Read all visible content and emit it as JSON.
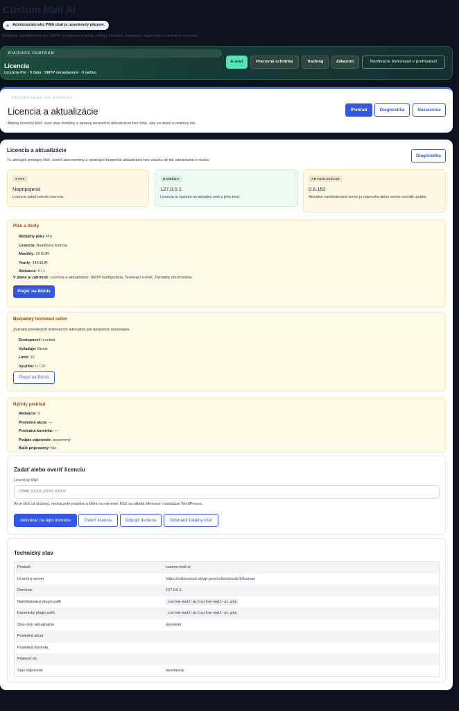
{
  "app": {
    "title": "Custom Mail AI",
    "pwa_badge": "Administrátorský PWA obal je uzamknutý plánom.",
    "subtitle": "Oddelená administrácia pre SMTP, testovacie e-maily, odbery, kontakty, kampane, diagnostiku a licenčné overenie."
  },
  "control_center": {
    "label": "RIADIACE CENTRUM",
    "title": "Licencia",
    "meta": "Licencia Pro · 0 čaká · SMTP nenastavené · 0 naživo",
    "nav": [
      {
        "label": "E-mail",
        "state": "active"
      },
      {
        "label": "Pracovná schránka",
        "state": "normal"
      },
      {
        "label": "Tracking",
        "state": "normal"
      },
      {
        "label": "Zákazníci",
        "state": "normal"
      },
      {
        "label": "Notifikácie blokované v prehliadači",
        "state": "disabled"
      }
    ]
  },
  "hero": {
    "eyebrow": "PRIPRAVENÉ NA PREDAJ",
    "title": "Licencia a aktualizácie",
    "desc": "Aktivuj licenčný kľúč, over stav domény a spravuj bezpečné aktualizácie bez toho, aby sa menil e-mailový tok.",
    "buttons": {
      "overview": "Prehľad",
      "diagnostics": "Diagnostika",
      "settings": "Nastavenia"
    }
  },
  "main": {
    "title": "Licencia a aktualizácie",
    "desc": "Tu aktivuješ predajný kľúč, overíš stav domény a spravuješ bezpečné aktualizácie bez zásahu do tok odosielania e-mailov.",
    "diagnostics_button": "Diagnostika",
    "stats": [
      {
        "label": "STAV",
        "value": "Nepripojená",
        "note": "Licencia zatiaľ nebola overená."
      },
      {
        "label": "DOMÉNA",
        "value": "127.0.0.1",
        "note": "Licencia je viazaná na aktuálny web a jeho host."
      },
      {
        "label": "AKTUALIZÁCIE",
        "value": "0.6.152",
        "note": "Aktuálne nainštalovaná verzia je najnovšia alebo server nevrátil update."
      }
    ],
    "plan": {
      "title": "Plán a limity",
      "rows": [
        {
          "k": "Aktuálny plán:",
          "v": "Pro"
        },
        {
          "k": "Licencia:",
          "v": "Neaktívna licencia"
        },
        {
          "k": "Monthly:",
          "v": "15 EUR"
        },
        {
          "k": "Yearly:",
          "v": "149 EUR"
        },
        {
          "k": "Aktivácie:",
          "v": "0 / 1"
        }
      ],
      "included_label": "V pláne je zahrnuté:",
      "included_value": "Licencia a aktualizácie, SMTP konfigurácia, Testovací e-mail, Záznamy doručovania",
      "button": "Prejsť na Biznis"
    },
    "test_mode": {
      "title": "Bezpečný testovací režim",
      "desc": "Zoznam povolených testovacích adresátov pre bezpečné overovanie.",
      "rows": [
        {
          "k": "Dostupnosť:",
          "v": "Locked"
        },
        {
          "k": "Vyžaduje:",
          "v": "Biznis"
        },
        {
          "k": "Limit:",
          "v": "10"
        },
        {
          "k": "Využitie:",
          "v": "0 / 10"
        }
      ],
      "button": "Prejsť na Biznis"
    },
    "quick": {
      "title": "Rýchly prehľad",
      "rows": [
        {
          "k": "Aktivácie:",
          "v": "0"
        },
        {
          "k": "Posledná akcia:",
          "v": "—"
        },
        {
          "k": "Posledná kontrola:",
          "v": "—"
        },
        {
          "k": "Podpis odpovede:",
          "v": "neoverený"
        },
        {
          "k": "Balík pripravený:",
          "v": "Nie"
        }
      ]
    },
    "license_form": {
      "title": "Zadať alebo overiť licenciu",
      "field_label": "Licenčný kľúč",
      "placeholder": "CMAI-XXXX-XXXX-XXXX",
      "help": "Ak je kľúč už uložený, nechaj pole prázdne a klikni na overenie. Kľúč sa ukladá šifrovane v databáze WordPressu.",
      "buttons": {
        "activate": "Aktivovať na tejto doméne",
        "verify": "Overiť licenciu",
        "disconnect": "Odpojiť doménu",
        "remove": "Odstrániť lokálny kľúč"
      }
    },
    "tech": {
      "title": "Technický stav",
      "rows": [
        {
          "k": "Produkt",
          "v": "custom-mail-ai",
          "code": false
        },
        {
          "k": "Licenčný server",
          "v": "https://cottoncloud.sk/wp-json/cottoncloud/v1/license/",
          "code": false
        },
        {
          "k": "Doména",
          "v": "127.0.0.1",
          "code": false
        },
        {
          "k": "Nainštalovaný plugin path",
          "v": "custom-mail-ai/custom-mail-ai.php",
          "code": true
        },
        {
          "k": "Kanonický plugin path",
          "v": "custom-mail-ai/custom-mail-ai.php",
          "code": true
        },
        {
          "k": "One-click aktualizácie",
          "v": "povolené",
          "code": false
        },
        {
          "k": "Posledná akcia",
          "v": "",
          "code": false
        },
        {
          "k": "Posledná kontrola",
          "v": "",
          "code": false
        },
        {
          "k": "Platnosť do",
          "v": "",
          "code": false
        },
        {
          "k": "Stav odpovede",
          "v": "neoverená",
          "code": false
        }
      ]
    }
  },
  "colors": {
    "accent": "#3458e6",
    "mint": "#57e3b6",
    "warning_bg": "#fffae6",
    "dark_bg": "#0c111d"
  }
}
